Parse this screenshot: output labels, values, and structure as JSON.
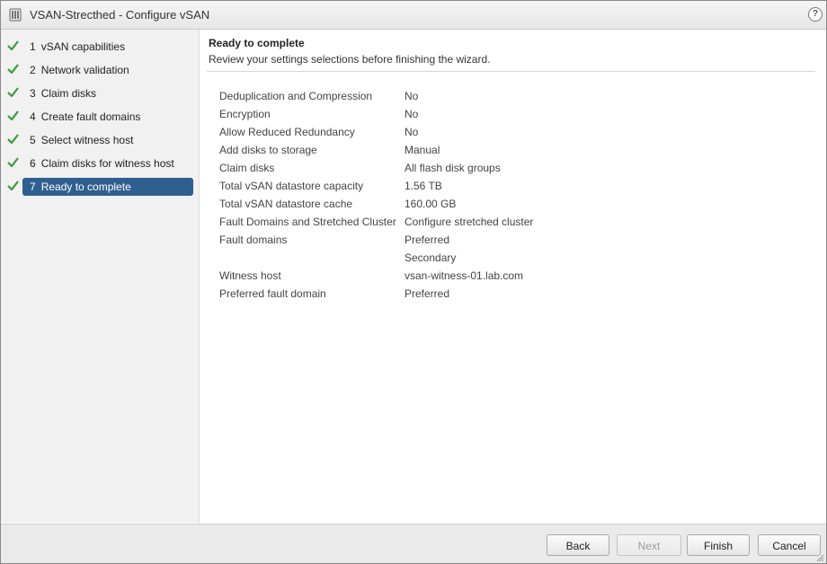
{
  "window": {
    "title": "VSAN-Strecthed - Configure vSAN",
    "help_label": "?"
  },
  "sidebar": {
    "steps": [
      {
        "num": "1",
        "label": "vSAN capabilities",
        "completed": true,
        "active": false
      },
      {
        "num": "2",
        "label": "Network validation",
        "completed": true,
        "active": false
      },
      {
        "num": "3",
        "label": "Claim disks",
        "completed": true,
        "active": false
      },
      {
        "num": "4",
        "label": "Create fault domains",
        "completed": true,
        "active": false
      },
      {
        "num": "5",
        "label": "Select witness host",
        "completed": true,
        "active": false
      },
      {
        "num": "6",
        "label": "Claim disks for witness host",
        "completed": true,
        "active": false
      },
      {
        "num": "7",
        "label": "Ready to complete",
        "completed": true,
        "active": true
      }
    ]
  },
  "main": {
    "heading": "Ready to complete",
    "subheading": "Review your settings selections before finishing the wizard.",
    "summary": [
      {
        "key": "Deduplication and Compression",
        "value": "No"
      },
      {
        "key": "Encryption",
        "value": "No"
      },
      {
        "key": "Allow Reduced Redundancy",
        "value": "No"
      },
      {
        "key": "Add disks to storage",
        "value": "Manual"
      },
      {
        "key": "Claim disks",
        "value": "All flash disk groups"
      },
      {
        "key": "Total vSAN datastore capacity",
        "value": "1.56 TB"
      },
      {
        "key": "Total vSAN datastore cache",
        "value": "160.00 GB"
      },
      {
        "key": "Fault Domains and Stretched Cluster",
        "value": "Configure stretched cluster"
      },
      {
        "key": "Fault domains",
        "value": "Preferred"
      },
      {
        "key": "",
        "value": "Secondary"
      },
      {
        "key": "Witness host",
        "value": "vsan-witness-01.lab.com"
      },
      {
        "key": "Preferred fault domain",
        "value": "Preferred"
      }
    ]
  },
  "footer": {
    "back_label": "Back",
    "next_label": "Next",
    "finish_label": "Finish",
    "cancel_label": "Cancel"
  },
  "colors": {
    "accent": "#2f5f8f",
    "check": "#3a9a3a"
  },
  "icons": {
    "app": "vsan-cluster-icon",
    "help": "help-icon",
    "step_done": "checkmark-icon"
  }
}
